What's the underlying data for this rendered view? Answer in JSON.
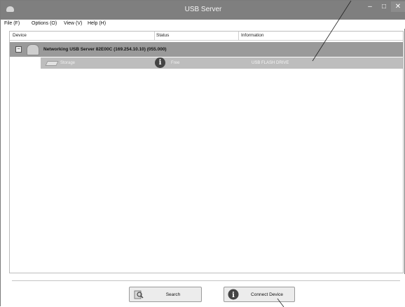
{
  "window": {
    "title": "USB Server",
    "controls": {
      "minimize": "–",
      "maximize": "□",
      "close": "✕"
    }
  },
  "menu": [
    {
      "label": "File (F)"
    },
    {
      "label": "Options (O)"
    },
    {
      "label": "View (V)"
    },
    {
      "label": "Help (H)"
    }
  ],
  "table": {
    "columns": [
      "Device",
      "Status",
      "Information"
    ],
    "server": {
      "expander": "−",
      "label": "Networking USB Server 82E00C  (169.254.10.10)  (055.000)"
    },
    "devices": [
      {
        "name": "Storage",
        "status": "Free",
        "information": "USB FLASH DRIVE",
        "status_icon": "i"
      }
    ]
  },
  "buttons": {
    "search": "Search",
    "connect": "Connect Device"
  },
  "colors": {
    "titlebar": "#7f7f7f",
    "server_row": "#9a9a9a",
    "device_row": "#bdbdbd"
  }
}
